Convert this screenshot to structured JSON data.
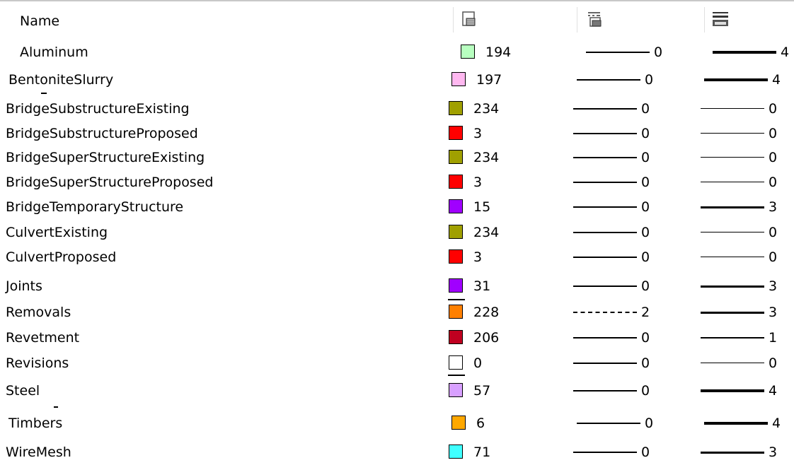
{
  "header": {
    "name_label": "Name",
    "color_column_icon": "color-icon",
    "style_column_icon": "line-style-icon",
    "weight_column_icon": "line-weight-icon"
  },
  "rows": [
    {
      "name": "Aluminum",
      "color_hex": "#b8ffc0",
      "color_num": "194",
      "style": "solid",
      "style_num": "0",
      "weight_num": "4"
    },
    {
      "name": "BentoniteSlurry",
      "color_hex": "#ffb8f0",
      "color_num": "197",
      "style": "solid",
      "style_num": "0",
      "weight_num": "4"
    },
    {
      "name": "BridgeSubstructureExisting",
      "color_hex": "#a0a000",
      "color_num": "234",
      "style": "solid",
      "style_num": "0",
      "weight_num": "0"
    },
    {
      "name": "BridgeSubstructureProposed",
      "color_hex": "#ff0000",
      "color_num": "3",
      "style": "solid",
      "style_num": "0",
      "weight_num": "0"
    },
    {
      "name": "BridgeSuperStructureExisting",
      "color_hex": "#a0a000",
      "color_num": "234",
      "style": "solid",
      "style_num": "0",
      "weight_num": "0"
    },
    {
      "name": "BridgeSuperStructureProposed",
      "color_hex": "#ff0000",
      "color_num": "3",
      "style": "solid",
      "style_num": "0",
      "weight_num": "0"
    },
    {
      "name": "BridgeTemporaryStructure",
      "color_hex": "#a000ff",
      "color_num": "15",
      "style": "solid",
      "style_num": "0",
      "weight_num": "3"
    },
    {
      "name": "CulvertExisting",
      "color_hex": "#a0a000",
      "color_num": "234",
      "style": "solid",
      "style_num": "0",
      "weight_num": "0"
    },
    {
      "name": "CulvertProposed",
      "color_hex": "#ff0000",
      "color_num": "3",
      "style": "solid",
      "style_num": "0",
      "weight_num": "0"
    },
    {
      "name": "Joints",
      "color_hex": "#a000ff",
      "color_num": "31",
      "style": "solid",
      "style_num": "0",
      "weight_num": "3"
    },
    {
      "name": "Removals",
      "color_hex": "#ff8000",
      "color_num": "228",
      "style": "dashed",
      "style_num": "2",
      "weight_num": "3"
    },
    {
      "name": "Revetment",
      "color_hex": "#c00020",
      "color_num": "206",
      "style": "solid",
      "style_num": "0",
      "weight_num": "1"
    },
    {
      "name": "Revisions",
      "color_hex": "#ffffff",
      "color_num": "0",
      "style": "solid",
      "style_num": "0",
      "weight_num": "0"
    },
    {
      "name": "Steel",
      "color_hex": "#d8a0ff",
      "color_num": "57",
      "style": "solid",
      "style_num": "0",
      "weight_num": "4"
    },
    {
      "name": "Timbers",
      "color_hex": "#ffa800",
      "color_num": "6",
      "style": "solid",
      "style_num": "0",
      "weight_num": "4"
    },
    {
      "name": "WireMesh",
      "color_hex": "#40ffff",
      "color_num": "71",
      "style": "solid",
      "style_num": "0",
      "weight_num": "3"
    }
  ]
}
